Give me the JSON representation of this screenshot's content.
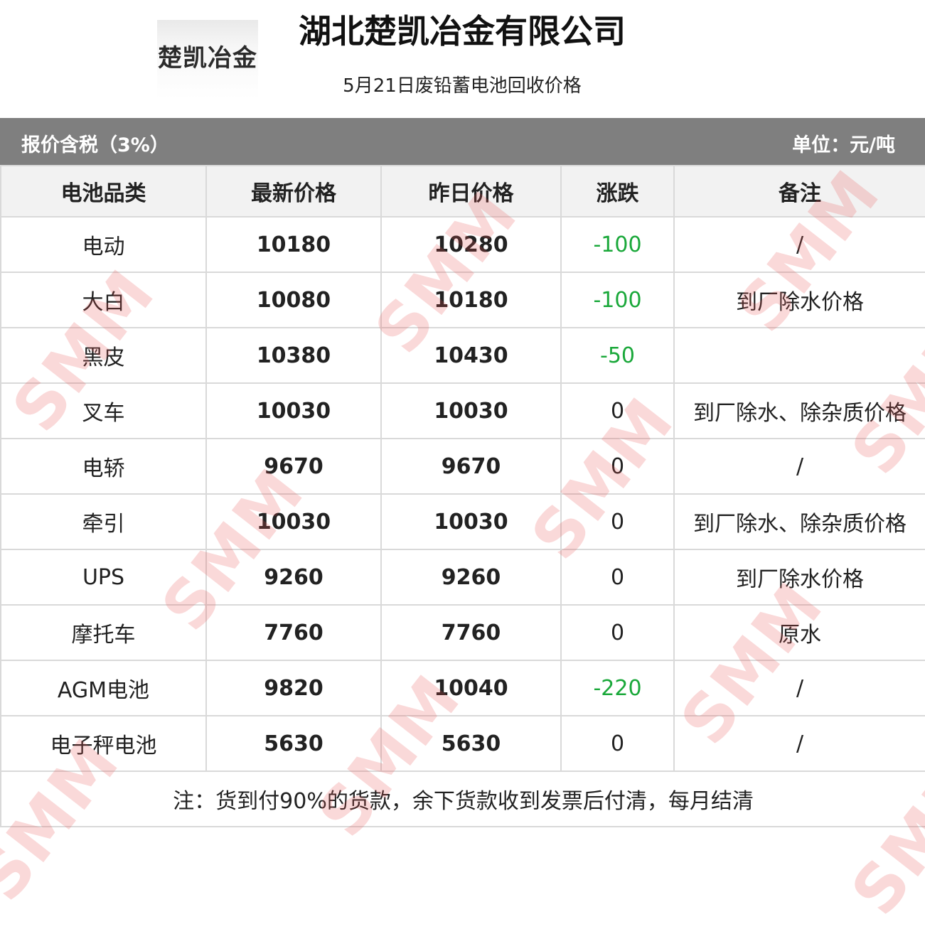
{
  "header": {
    "logo_text": "楚凯冶金",
    "company": "湖北楚凯冶金有限公司",
    "subtitle": "5月21日废铅蓄电池回收价格"
  },
  "bar": {
    "left": "报价含税（3%）",
    "right": "单位：元/吨"
  },
  "table": {
    "columns": [
      "电池品类",
      "最新价格",
      "昨日价格",
      "涨跌",
      "备注"
    ],
    "rows": [
      {
        "category": "电动",
        "latest": "10180",
        "yesterday": "10280",
        "change": "-100",
        "remark": "/"
      },
      {
        "category": "大白",
        "latest": "10080",
        "yesterday": "10180",
        "change": "-100",
        "remark": "到厂除水价格"
      },
      {
        "category": "黑皮",
        "latest": "10380",
        "yesterday": "10430",
        "change": "-50",
        "remark": ""
      },
      {
        "category": "叉车",
        "latest": "10030",
        "yesterday": "10030",
        "change": "0",
        "remark": "到厂除水、除杂质价格"
      },
      {
        "category": "电轿",
        "latest": "9670",
        "yesterday": "9670",
        "change": "0",
        "remark": "/"
      },
      {
        "category": "牵引",
        "latest": "10030",
        "yesterday": "10030",
        "change": "0",
        "remark": "到厂除水、除杂质价格"
      },
      {
        "category": "UPS",
        "latest": "9260",
        "yesterday": "9260",
        "change": "0",
        "remark": "到厂除水价格"
      },
      {
        "category": "摩托车",
        "latest": "7760",
        "yesterday": "7760",
        "change": "0",
        "remark": "原水"
      },
      {
        "category": "AGM电池",
        "latest": "9820",
        "yesterday": "10040",
        "change": "-220",
        "remark": "/"
      },
      {
        "category": "电子秤电池",
        "latest": "5630",
        "yesterday": "5630",
        "change": "0",
        "remark": "/"
      }
    ],
    "note": "注：货到付90%的货款，余下货款收到发票后付清，每月结清"
  },
  "watermark": {
    "text": "SMM"
  },
  "colors": {
    "bar": "#7f7f7f",
    "negative": "#1aa83a",
    "header_bg": "#f2f2f2",
    "watermark": "#e65050"
  }
}
